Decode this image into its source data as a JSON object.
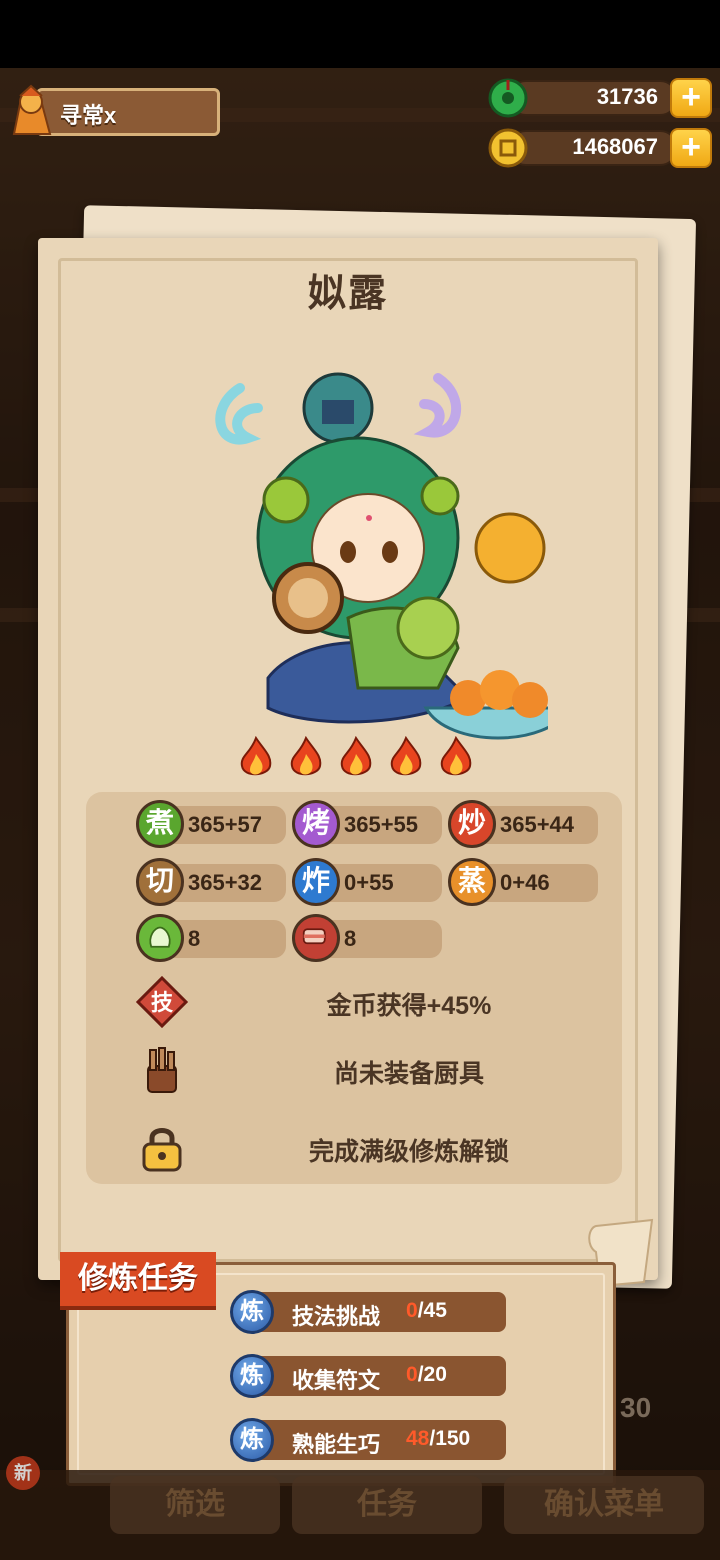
{
  "player": {
    "name": "寻常x"
  },
  "currencies": [
    {
      "icon": "jade-coin-icon",
      "value": "31736"
    },
    {
      "icon": "gold-coin-icon",
      "value": "1468067"
    }
  ],
  "chef": {
    "name": "姒露",
    "rarity_flames": 5,
    "stats": [
      {
        "icon_char": "煮",
        "label": "boil",
        "value": "365+57",
        "color": "#5aa62e"
      },
      {
        "icon_char": "烤",
        "label": "roast",
        "value": "365+55",
        "color": "#a45ad0"
      },
      {
        "icon_char": "炒",
        "label": "stir-fry",
        "value": "365+44",
        "color": "#d8462a"
      },
      {
        "icon_char": "切",
        "label": "cut",
        "value": "365+32",
        "color": "#a0703a"
      },
      {
        "icon_char": "炸",
        "label": "fry",
        "value": "0+55",
        "color": "#2e7ad0"
      },
      {
        "icon_char": "蒸",
        "label": "steam",
        "value": "0+46",
        "color": "#e8902a"
      },
      {
        "icon_char": "",
        "label": "vegetable",
        "value": "8",
        "color": "#6ab83a"
      },
      {
        "icon_char": "",
        "label": "meat",
        "value": "8",
        "color": "#c24034"
      }
    ],
    "skill": {
      "icon_char": "技",
      "text": "金币获得+45%"
    },
    "equipment": {
      "text": "尚未装备厨具"
    },
    "locked": {
      "text": "完成满级修炼解锁"
    }
  },
  "tasks": {
    "title": "修炼任务",
    "items": [
      {
        "badge": "炼",
        "name": "技法挑战",
        "current": "0",
        "total": "/45"
      },
      {
        "badge": "炼",
        "name": "收集符文",
        "current": "0",
        "total": "/20"
      },
      {
        "badge": "炼",
        "name": "熟能生巧",
        "current": "48",
        "total": "/150"
      }
    ]
  },
  "background": {
    "buttons": [
      "筛选",
      "任务",
      "确认菜单"
    ],
    "new_badge": "新",
    "level": "30"
  }
}
